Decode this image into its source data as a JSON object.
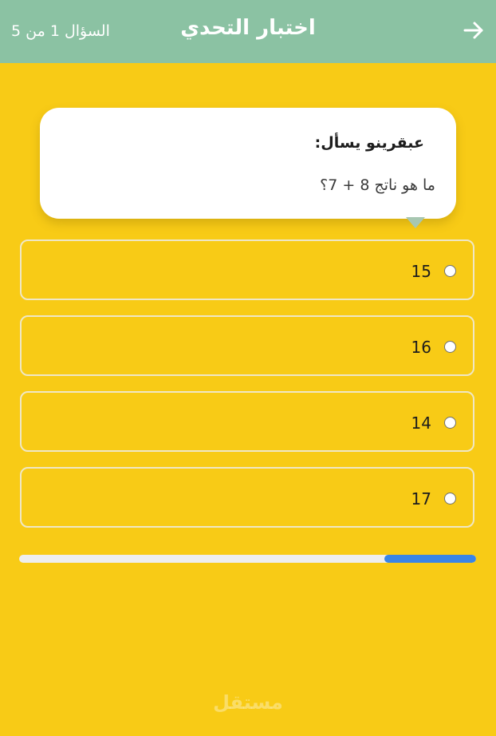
{
  "header": {
    "title": "اختبار التحدي",
    "progress_text": "السؤال 1 من 5",
    "back_icon": "arrow-right-icon"
  },
  "question": {
    "asker": "عبقرينو يسأل:",
    "text": "ما هو ناتج 8 + 7؟"
  },
  "options": [
    {
      "label": "15",
      "selected": false
    },
    {
      "label": "16",
      "selected": false
    },
    {
      "label": "14",
      "selected": false
    },
    {
      "label": "17",
      "selected": false
    }
  ],
  "progress": {
    "fraction": 0.2
  },
  "watermark": {
    "text": "مستقل"
  },
  "colors": {
    "background": "#f8cb16",
    "header": "#8bc2a3",
    "progress_fill": "#3a85e6"
  }
}
